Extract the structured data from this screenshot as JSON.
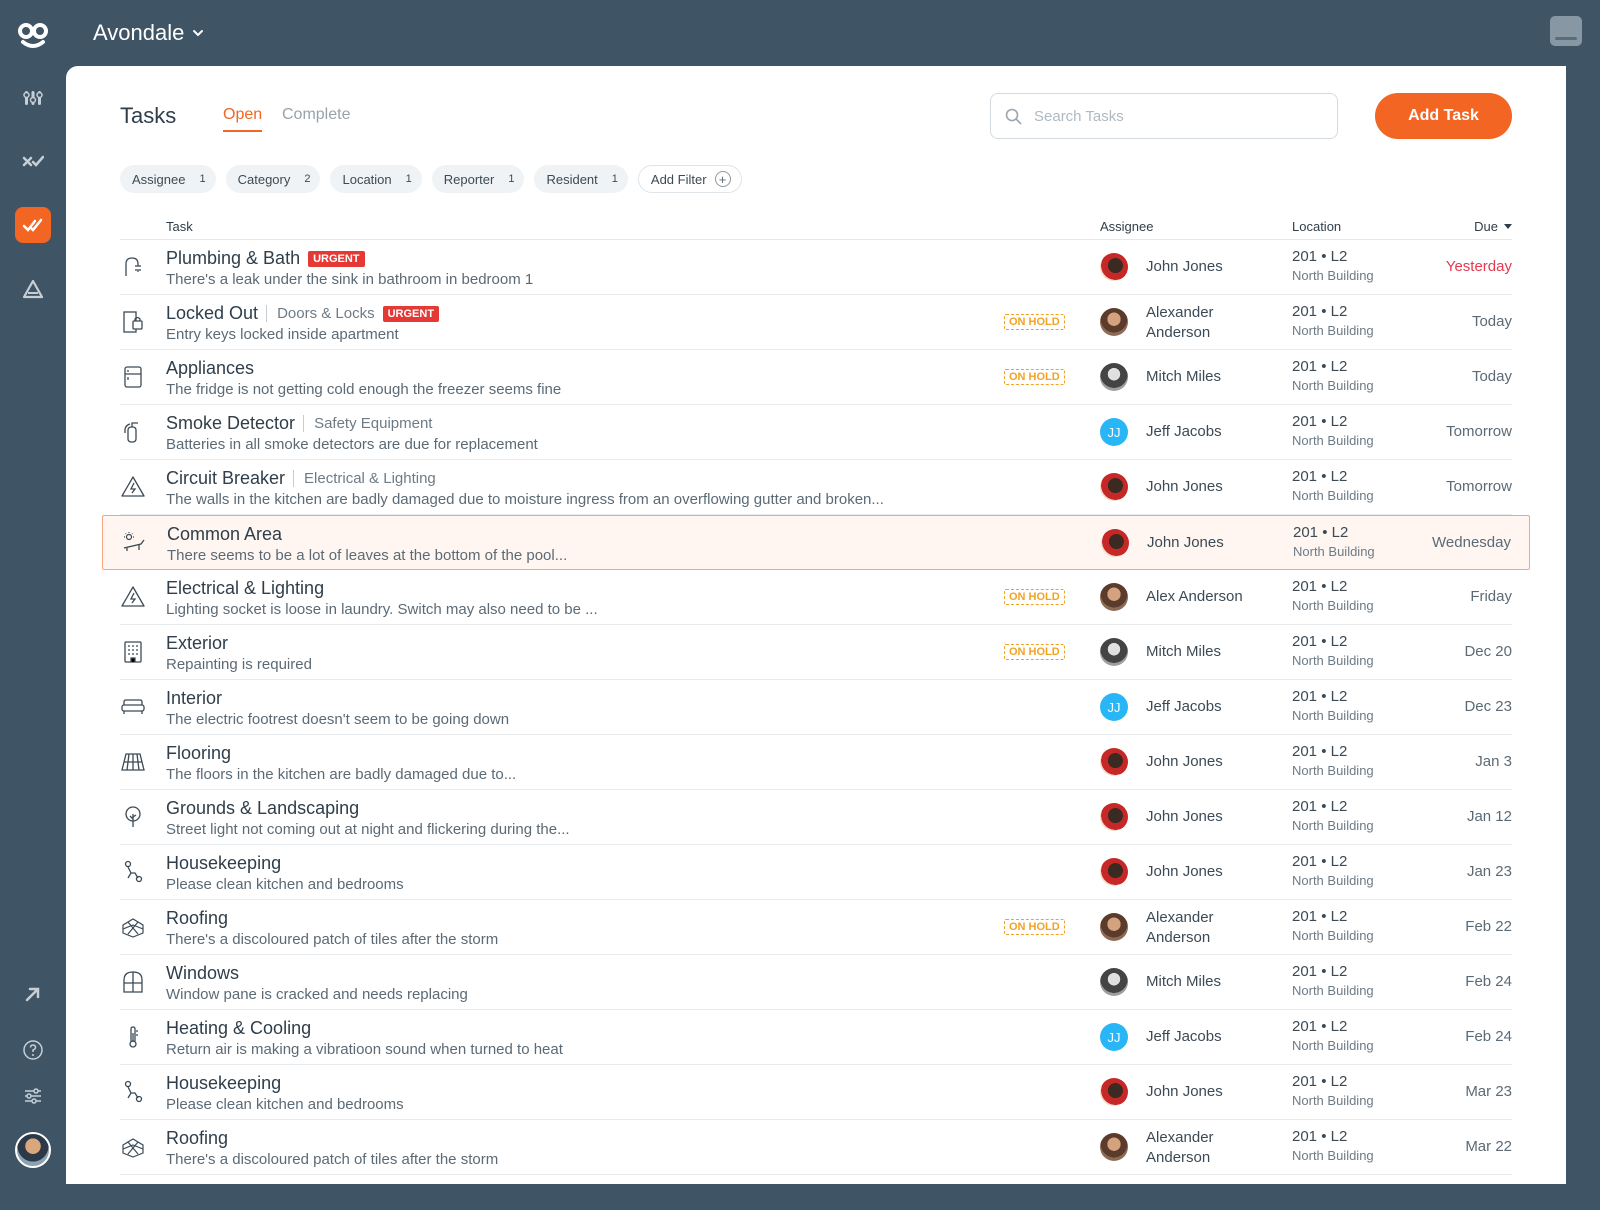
{
  "app": {
    "property_name": "Avondale"
  },
  "sidebar": {
    "items": [
      {
        "name": "dashboard",
        "icon": "bars-icon"
      },
      {
        "name": "checks",
        "icon": "x-check-icon"
      },
      {
        "name": "tasks",
        "icon": "double-check-icon",
        "active": true
      },
      {
        "name": "warnings",
        "icon": "triangle-icon"
      }
    ]
  },
  "page": {
    "title": "Tasks",
    "tabs": [
      "Open",
      "Complete"
    ],
    "search_placeholder": "Search Tasks",
    "add_task_label": "Add Task"
  },
  "filters": [
    {
      "label": "Assignee",
      "count": "1"
    },
    {
      "label": "Category",
      "count": "2"
    },
    {
      "label": "Location",
      "count": "1"
    },
    {
      "label": "Reporter",
      "count": "1"
    },
    {
      "label": "Resident",
      "count": "1"
    }
  ],
  "add_filter_label": "Add Filter",
  "columns": {
    "task": "Task",
    "assignee": "Assignee",
    "location": "Location",
    "due": "Due"
  },
  "colors": {
    "accent": "#f26522",
    "urgent": "#e53935",
    "on_hold": "#f2a325",
    "sidebar": "#3f5465"
  },
  "tasks": [
    {
      "title": "Plumbing & Bath",
      "sub": "",
      "urgent": "URGENT",
      "hold": "",
      "desc": "There's a leak under the sink in bathroom in bedroom 1",
      "av": "red",
      "assignee": "John Jones",
      "unit": "201 • L2",
      "building": "North Building",
      "due": "Yesterday",
      "late": true,
      "icon": "faucet-icon"
    },
    {
      "title": "Locked Out",
      "sub": "Doors & Locks",
      "urgent": "URGENT",
      "hold": "ON HOLD",
      "desc": "Entry keys locked inside apartment",
      "av": "brown",
      "assignee": "Alexander Anderson",
      "unit": "201 • L2",
      "building": "North Building",
      "due": "Today",
      "icon": "door-lock-icon"
    },
    {
      "title": "Appliances",
      "sub": "",
      "urgent": "",
      "hold": "ON HOLD",
      "desc": "The fridge is not getting cold enough the freezer seems fine",
      "av": "gray",
      "assignee": "Mitch Miles",
      "unit": "201 • L2",
      "building": "North Building",
      "due": "Today",
      "icon": "fridge-icon"
    },
    {
      "title": "Smoke Detector",
      "sub": "Safety Equipment",
      "urgent": "",
      "hold": "",
      "desc": "Batteries in all smoke detectors are due for replacement",
      "av": "jj",
      "av_text": "JJ",
      "assignee": "Jeff Jacobs",
      "unit": "201 • L2",
      "building": "North Building",
      "due": "Tomorrow",
      "icon": "extinguisher-icon"
    },
    {
      "title": "Circuit Breaker",
      "sub": "Electrical & Lighting",
      "urgent": "",
      "hold": "",
      "desc": "The walls in the kitchen are badly damaged due to moisture ingress from an overflowing gutter and broken...",
      "av": "red",
      "assignee": "John Jones",
      "unit": "201 • L2",
      "building": "North Building",
      "due": "Tomorrow",
      "icon": "electric-warning-icon"
    },
    {
      "title": "Common Area",
      "sub": "",
      "urgent": "",
      "hold": "",
      "desc": "There seems to be a lot of leaves at the bottom of the pool...",
      "av": "red",
      "assignee": "John Jones",
      "unit": "201 • L2",
      "building": "North Building",
      "due": "Wednesday",
      "selected": true,
      "icon": "sun-lounger-icon"
    },
    {
      "title": "Electrical & Lighting",
      "sub": "",
      "urgent": "",
      "hold": "ON HOLD",
      "desc": "Lighting socket is loose in laundry. Switch may also need to be ...",
      "av": "brown",
      "assignee": "Alex Anderson",
      "unit": "201 • L2",
      "building": "North Building",
      "due": "Friday",
      "icon": "electric-warning-icon"
    },
    {
      "title": "Exterior",
      "sub": "",
      "urgent": "",
      "hold": "ON HOLD",
      "desc": "Repainting is required",
      "av": "gray",
      "assignee": "Mitch Miles",
      "unit": "201 • L2",
      "building": "North Building",
      "due": "Dec 20",
      "icon": "building-icon"
    },
    {
      "title": "Interior",
      "sub": "",
      "urgent": "",
      "hold": "",
      "desc": "The electric footrest doesn't seem to be going down",
      "av": "jj",
      "av_text": "JJ",
      "assignee": "Jeff Jacobs",
      "unit": "201 • L2",
      "building": "North Building",
      "due": "Dec 23",
      "icon": "sofa-icon"
    },
    {
      "title": "Flooring",
      "sub": "",
      "urgent": "",
      "hold": "",
      "desc": "The floors in the kitchen are badly damaged due to...",
      "av": "red",
      "assignee": "John Jones",
      "unit": "201 • L2",
      "building": "North Building",
      "due": "Jan 3",
      "icon": "floor-tiles-icon"
    },
    {
      "title": "Grounds & Landscaping",
      "sub": "",
      "urgent": "",
      "hold": "",
      "desc": "Street light not coming out at night and flickering during the...",
      "av": "red",
      "assignee": "John Jones",
      "unit": "201 • L2",
      "building": "North Building",
      "due": "Jan 12",
      "icon": "tree-icon"
    },
    {
      "title": "Housekeeping",
      "sub": "",
      "urgent": "",
      "hold": "",
      "desc": "Please clean kitchen and bedrooms",
      "av": "red",
      "assignee": "John Jones",
      "unit": "201 • L2",
      "building": "North Building",
      "due": "Jan 23",
      "icon": "vacuum-icon"
    },
    {
      "title": "Roofing",
      "sub": "",
      "urgent": "",
      "hold": "ON HOLD",
      "desc": "There's a discoloured patch of tiles after the storm",
      "av": "brown",
      "assignee": "Alexander Anderson",
      "unit": "201 • L2",
      "building": "North Building",
      "due": "Feb 22",
      "icon": "roof-tiles-icon"
    },
    {
      "title": "Windows",
      "sub": "",
      "urgent": "",
      "hold": "",
      "desc": "Window pane is cracked and needs replacing",
      "av": "gray",
      "assignee": "Mitch Miles",
      "unit": "201 • L2",
      "building": "North Building",
      "due": "Feb 24",
      "icon": "window-icon"
    },
    {
      "title": "Heating & Cooling",
      "sub": "",
      "urgent": "",
      "hold": "",
      "desc": "Return air is making a vibratioon sound when turned to heat",
      "av": "jj",
      "av_text": "JJ",
      "assignee": "Jeff Jacobs",
      "unit": "201 • L2",
      "building": "North Building",
      "due": "Feb 24",
      "icon": "thermometer-icon"
    },
    {
      "title": "Housekeeping",
      "sub": "",
      "urgent": "",
      "hold": "",
      "desc": "Please clean kitchen and bedrooms",
      "av": "red",
      "assignee": "John Jones",
      "unit": "201 • L2",
      "building": "North Building",
      "due": "Mar 23",
      "icon": "vacuum-icon"
    },
    {
      "title": "Roofing",
      "sub": "",
      "urgent": "",
      "hold": "",
      "desc": "There's a discoloured patch of tiles after the storm",
      "av": "brown",
      "assignee": "Alexander Anderson",
      "unit": "201 • L2",
      "building": "North Building",
      "due": "Mar 22",
      "icon": "roof-tiles-icon"
    }
  ]
}
